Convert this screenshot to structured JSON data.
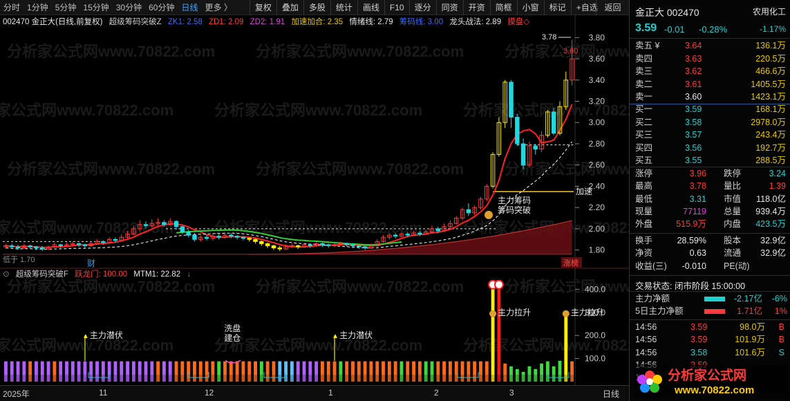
{
  "toolbar": {
    "periods": [
      "分时",
      "1分钟",
      "5分钟",
      "15分钟",
      "30分钟",
      "60分钟",
      "日线",
      "更多 〉"
    ],
    "active_period": "日线",
    "tools": [
      "复权",
      "叠加",
      "多股",
      "统计",
      "画线",
      "F10",
      "逐分",
      "同资",
      "开资",
      "简框",
      "小窗",
      "标记",
      "+自选"
    ],
    "return_label": "返回"
  },
  "legend_main": {
    "code_title": "002470 金正大(日线,前复权)",
    "indicator": "超级筹码突破Z",
    "zk1": "ZK1: 2.58",
    "zd1": "ZD1: 2.09",
    "zd2": "ZD2: 1.91",
    "accel": "加速加合: 2.35",
    "emotion": "情绪线: 2.79",
    "hidden": "筹码线: 3.00",
    "dragon": "龙头战法: 2.89",
    "flag": "摸盘◇"
  },
  "legend_sub": {
    "indicator": "超级筹码突破F",
    "dragon_gate": "跃龙门: 100.00",
    "mtm": "MTM1: 22.82"
  },
  "chart_data": {
    "type": "candlestick",
    "title": "002470 金正大(日线,前复权)",
    "y_main_ticks": [
      3.8,
      3.6,
      3.4,
      3.2,
      3.0,
      2.8,
      2.6,
      2.4,
      2.2,
      2.0,
      1.8
    ],
    "y_main_range": [
      1.7,
      3.88
    ],
    "y_sub_ticks": [
      400.0,
      300.0,
      200.0,
      100.0
    ],
    "y_sub_range": [
      0,
      440
    ],
    "x_labels": [
      "2025年",
      "11",
      "12",
      "1",
      "2",
      "3"
    ],
    "annotations": {
      "high_mark": "3.78",
      "close_mark": "3.60",
      "low_mark": "1.70",
      "accel_label": "加速",
      "breakout_labels": [
        "主力筹码",
        "筹码突破"
      ],
      "finance_tag": "财",
      "limit_tag": "涨榜"
    },
    "sub_annotations": [
      "主力潜伏",
      "洗盘建仓",
      "主力潜伏",
      "主力拉升",
      "主力拉升"
    ],
    "candles": [
      [
        1.83,
        1.84,
        1.86,
        1.81
      ],
      [
        1.84,
        1.83,
        1.86,
        1.81
      ],
      [
        1.83,
        1.82,
        1.85,
        1.8
      ],
      [
        1.82,
        1.84,
        1.86,
        1.81
      ],
      [
        1.84,
        1.83,
        1.85,
        1.81
      ],
      [
        1.83,
        1.82,
        1.84,
        1.8
      ],
      [
        1.82,
        1.81,
        1.84,
        1.79
      ],
      [
        1.81,
        1.83,
        1.84,
        1.8
      ],
      [
        1.83,
        1.85,
        1.87,
        1.82
      ],
      [
        1.85,
        1.84,
        1.86,
        1.82
      ],
      [
        1.84,
        1.85,
        1.87,
        1.83
      ],
      [
        1.85,
        1.86,
        1.88,
        1.84
      ],
      [
        1.86,
        1.85,
        1.87,
        1.83
      ],
      [
        1.85,
        1.84,
        1.86,
        1.82
      ],
      [
        1.84,
        1.86,
        1.88,
        1.83
      ],
      [
        1.86,
        1.88,
        1.9,
        1.85
      ],
      [
        1.88,
        1.87,
        1.89,
        1.85
      ],
      [
        1.87,
        1.9,
        1.92,
        1.86
      ],
      [
        1.9,
        1.89,
        1.92,
        1.87
      ],
      [
        1.89,
        1.92,
        1.95,
        1.88
      ],
      [
        1.92,
        1.95,
        1.98,
        1.91
      ],
      [
        1.95,
        2.0,
        2.03,
        1.94
      ],
      [
        2.0,
        2.04,
        2.08,
        1.98
      ],
      [
        2.04,
        2.03,
        2.07,
        2.0
      ],
      [
        2.03,
        2.05,
        2.09,
        2.01
      ],
      [
        2.05,
        2.06,
        2.1,
        2.03
      ],
      [
        2.06,
        2.04,
        2.08,
        2.02
      ],
      [
        2.04,
        2.07,
        2.1,
        2.03
      ],
      [
        2.07,
        2.02,
        2.08,
        1.99
      ],
      [
        2.02,
        1.97,
        2.03,
        1.95
      ],
      [
        1.97,
        1.94,
        1.99,
        1.92
      ],
      [
        1.94,
        1.9,
        1.96,
        1.88
      ],
      [
        1.9,
        1.92,
        1.94,
        1.88
      ],
      [
        1.92,
        1.91,
        1.94,
        1.89
      ],
      [
        1.91,
        1.93,
        1.95,
        1.89
      ],
      [
        1.93,
        1.92,
        1.95,
        1.9
      ],
      [
        1.92,
        1.94,
        1.96,
        1.91
      ],
      [
        1.94,
        1.93,
        1.96,
        1.91
      ],
      [
        1.93,
        1.92,
        1.94,
        1.9
      ],
      [
        1.92,
        1.91,
        1.93,
        1.89
      ],
      [
        1.91,
        1.9,
        1.92,
        1.88
      ],
      [
        1.9,
        1.88,
        1.91,
        1.86
      ],
      [
        1.88,
        1.86,
        1.89,
        1.84
      ],
      [
        1.86,
        1.84,
        1.87,
        1.82
      ],
      [
        1.84,
        1.82,
        1.85,
        1.8
      ],
      [
        1.82,
        1.81,
        1.84,
        1.79
      ],
      [
        1.81,
        1.83,
        1.85,
        1.8
      ],
      [
        1.83,
        1.84,
        1.86,
        1.82
      ],
      [
        1.84,
        1.83,
        1.85,
        1.81
      ],
      [
        1.83,
        1.85,
        1.87,
        1.82
      ],
      [
        1.85,
        1.84,
        1.86,
        1.82
      ],
      [
        1.84,
        1.86,
        1.88,
        1.83
      ],
      [
        1.86,
        1.85,
        1.87,
        1.83
      ],
      [
        1.85,
        1.84,
        1.86,
        1.82
      ],
      [
        1.84,
        1.85,
        1.87,
        1.83
      ],
      [
        1.85,
        1.86,
        1.88,
        1.84
      ],
      [
        1.86,
        1.85,
        1.87,
        1.83
      ],
      [
        1.85,
        1.84,
        1.86,
        1.82
      ],
      [
        1.84,
        1.83,
        1.85,
        1.81
      ],
      [
        1.83,
        1.82,
        1.84,
        1.8
      ],
      [
        1.82,
        1.84,
        1.86,
        1.81
      ],
      [
        1.84,
        1.88,
        1.9,
        1.83
      ],
      [
        1.88,
        1.92,
        1.94,
        1.87
      ],
      [
        1.92,
        1.94,
        1.96,
        1.9
      ],
      [
        1.94,
        1.93,
        1.96,
        1.91
      ],
      [
        1.93,
        1.95,
        1.97,
        1.92
      ],
      [
        1.95,
        1.94,
        1.97,
        1.92
      ],
      [
        1.94,
        1.96,
        1.98,
        1.93
      ],
      [
        1.96,
        1.95,
        1.98,
        1.93
      ],
      [
        1.95,
        1.97,
        1.99,
        1.94
      ],
      [
        1.97,
        2.0,
        2.03,
        1.96
      ],
      [
        2.0,
        1.98,
        2.02,
        1.96
      ],
      [
        1.98,
        2.02,
        2.05,
        1.97
      ],
      [
        2.02,
        2.05,
        2.08,
        2.0
      ],
      [
        2.05,
        2.1,
        2.12,
        2.04
      ],
      [
        2.1,
        2.18,
        2.2,
        2.08
      ],
      [
        2.18,
        2.15,
        2.24,
        2.12
      ],
      [
        2.15,
        2.2,
        2.22,
        2.13
      ],
      [
        2.2,
        2.28,
        2.3,
        2.18
      ],
      [
        2.28,
        2.4,
        2.42,
        2.26
      ],
      [
        2.4,
        2.7,
        2.72,
        2.38
      ],
      [
        2.7,
        3.0,
        3.05,
        2.68
      ],
      [
        3.0,
        3.38,
        3.4,
        2.95
      ],
      [
        3.38,
        3.05,
        3.4,
        2.95
      ],
      [
        3.05,
        2.8,
        3.08,
        2.78
      ],
      [
        2.8,
        2.6,
        2.85,
        2.56
      ],
      [
        2.6,
        2.78,
        2.82,
        2.58
      ],
      [
        2.78,
        2.75,
        2.8,
        2.7
      ],
      [
        2.75,
        2.88,
        2.92,
        2.72
      ],
      [
        2.88,
        3.1,
        3.12,
        2.86
      ],
      [
        3.1,
        2.9,
        3.14,
        2.88
      ],
      [
        2.9,
        3.15,
        3.2,
        2.88
      ],
      [
        3.15,
        3.4,
        3.48,
        3.12
      ],
      [
        3.4,
        3.6,
        3.78,
        3.35
      ]
    ],
    "sub_bars": [
      [
        88,
        "#b060ff"
      ],
      [
        88,
        "#b060ff"
      ],
      [
        88,
        "#b060ff"
      ],
      [
        88,
        "#b060ff"
      ],
      [
        88,
        "#ff6a1a"
      ],
      [
        88,
        "#b060ff"
      ],
      [
        88,
        "#b060ff"
      ],
      [
        88,
        "#b060ff"
      ],
      [
        88,
        "#ff6a1a"
      ],
      [
        88,
        "#b060ff"
      ],
      [
        88,
        "#b060ff"
      ],
      [
        88,
        "#b060ff"
      ],
      [
        88,
        "#b060ff"
      ],
      [
        88,
        "#b060ff"
      ],
      [
        88,
        "#b060ff"
      ],
      [
        88,
        "#b060ff"
      ],
      [
        88,
        "#b060ff"
      ],
      [
        88,
        "#b060ff"
      ],
      [
        88,
        "#b060ff"
      ],
      [
        88,
        "#b060ff"
      ],
      [
        88,
        "#b060ff"
      ],
      [
        88,
        "#b060ff"
      ],
      [
        88,
        "#b060ff"
      ],
      [
        88,
        "#b060ff"
      ],
      [
        88,
        "#b060ff"
      ],
      [
        88,
        "#ff6a1a"
      ],
      [
        88,
        "#b060ff"
      ],
      [
        88,
        "#b060ff"
      ],
      [
        88,
        "#ff6a1a"
      ],
      [
        88,
        "#ff6a1a"
      ],
      [
        88,
        "#ff6a1a"
      ],
      [
        88,
        "#ff6a1a"
      ],
      [
        88,
        "#ff6a1a"
      ],
      [
        88,
        "#ff6a1a"
      ],
      [
        88,
        "#ff6a1a"
      ],
      [
        88,
        "#40d840"
      ],
      [
        88,
        "#ff6a1a"
      ],
      [
        88,
        "#ff6a1a"
      ],
      [
        88,
        "#ff6a1a"
      ],
      [
        88,
        "#ff6a1a"
      ],
      [
        88,
        "#ff6a1a"
      ],
      [
        88,
        "#ff6a1a"
      ],
      [
        88,
        "#40d840"
      ],
      [
        88,
        "#ff6a1a"
      ],
      [
        88,
        "#ff6a1a"
      ],
      [
        88,
        "#60c0ff"
      ],
      [
        88,
        "#60c0ff"
      ],
      [
        88,
        "#60c0ff"
      ],
      [
        88,
        "#b060ff"
      ],
      [
        88,
        "#b060ff"
      ],
      [
        88,
        "#b060ff"
      ],
      [
        88,
        "#b060ff"
      ],
      [
        88,
        "#ff6a1a"
      ],
      [
        88,
        "#ff6a1a"
      ],
      [
        88,
        "#ff6a1a"
      ],
      [
        88,
        "#40d840"
      ],
      [
        88,
        "#ff6a1a"
      ],
      [
        88,
        "#ff6a1a"
      ],
      [
        88,
        "#ff6a1a"
      ],
      [
        88,
        "#ff6a1a"
      ],
      [
        88,
        "#ff6a1a"
      ],
      [
        88,
        "#ff6a1a"
      ],
      [
        88,
        "#ff6a1a"
      ],
      [
        88,
        "#ff6a1a"
      ],
      [
        88,
        "#ff6a1a"
      ],
      [
        88,
        "#40d840"
      ],
      [
        88,
        "#ff6a1a"
      ],
      [
        88,
        "#ff6a1a"
      ],
      [
        88,
        "#ff6a1a"
      ],
      [
        88,
        "#40d840"
      ],
      [
        88,
        "#40d840"
      ],
      [
        88,
        "#ff6a1a"
      ],
      [
        88,
        "#ff6a1a"
      ],
      [
        88,
        "#ff6a1a"
      ],
      [
        88,
        "#ff6a1a"
      ],
      [
        88,
        "#ff6a1a"
      ],
      [
        88,
        "#ff6a1a"
      ],
      [
        88,
        "#ff6a1a"
      ],
      [
        88,
        "#ff6a1a"
      ],
      [
        88,
        "#ff6a1a"
      ],
      [
        420,
        "#ffee00"
      ],
      [
        420,
        "#ff1a1a"
      ],
      [
        80,
        "#ff6a1a"
      ],
      [
        70,
        "#40d840"
      ],
      [
        60,
        "#40d840"
      ],
      [
        50,
        "#40d840"
      ],
      [
        70,
        "#40d840"
      ],
      [
        60,
        "#40d840"
      ],
      [
        80,
        "#40d840"
      ],
      [
        88,
        "#40d840"
      ],
      [
        70,
        "#40d840"
      ],
      [
        90,
        "#40d840"
      ],
      [
        300,
        "#ffee00"
      ],
      [
        88,
        "#ff6a1a"
      ]
    ]
  },
  "quote": {
    "title": "金正大 002470",
    "industry": "农用化工",
    "price": "3.59",
    "change": "-0.01",
    "pct": "-0.28%",
    "industry_pct": "-1.17%"
  },
  "asks": [
    {
      "label": "卖五 ¥",
      "price": "3.64",
      "vol": "136.1万"
    },
    {
      "label": "卖四",
      "price": "3.63",
      "vol": "220.5万"
    },
    {
      "label": "卖三",
      "price": "3.62",
      "vol": "466.6万"
    },
    {
      "label": "卖二",
      "price": "3.61",
      "vol": "1405.5万"
    },
    {
      "label": "卖一",
      "price": "3.60",
      "vol": "1423.1万"
    }
  ],
  "bids": [
    {
      "label": "买一",
      "price": "3.59",
      "vol": "168.1万"
    },
    {
      "label": "买二",
      "price": "3.58",
      "vol": "2978.0万"
    },
    {
      "label": "买三",
      "price": "3.57",
      "vol": "243.4万"
    },
    {
      "label": "买四",
      "price": "3.56",
      "vol": "192.7万"
    },
    {
      "label": "买五",
      "price": "3.55",
      "vol": "288.5万"
    }
  ],
  "stats": [
    {
      "k1": "涨停",
      "v1": "3.96",
      "c1": "red",
      "k2": "跌停",
      "v2": "3.24",
      "c2": "cyan"
    },
    {
      "k1": "最高",
      "v1": "3.78",
      "c1": "red",
      "k2": "量比",
      "v2": "1.39",
      "c2": "red"
    },
    {
      "k1": "最低",
      "v1": "3.31",
      "c1": "cyan",
      "k2": "市值",
      "v2": "118.0亿",
      "c2": "white"
    },
    {
      "k1": "现量",
      "v1": "77119",
      "c1": "mag",
      "k2": "总量",
      "v2": "939.4万",
      "c2": "white"
    },
    {
      "k1": "外盘",
      "v1": "515.9万",
      "c1": "red",
      "k2": "内盘",
      "v2": "423.5万",
      "c2": "cyan"
    }
  ],
  "stats2": [
    {
      "k1": "换手",
      "v1": "28.59%",
      "c1": "white",
      "k2": "股本",
      "v2": "32.9亿",
      "c2": "white"
    },
    {
      "k1": "净资",
      "v1": "0.63",
      "c1": "white",
      "k2": "流通",
      "v2": "32.9亿",
      "c2": "white"
    },
    {
      "k1": "收益(三)",
      "v1": "-0.010",
      "c1": "white",
      "k2": "PE(动)",
      "v2": "",
      "c2": "white"
    }
  ],
  "trade_status": "交易状态: 闭市阶段 15:00:00",
  "flow": [
    {
      "label": "主力净额",
      "value": "-2.17亿",
      "pct": "-6%",
      "color": "cyan"
    },
    {
      "label": "5日主力净额",
      "value": "1.71亿",
      "pct": "1%",
      "color": "red"
    }
  ],
  "ticks": [
    {
      "time": "14:56",
      "price": "3.59",
      "vol": "98.0万",
      "side": "B"
    },
    {
      "time": "14:56",
      "price": "3.59",
      "vol": "101.9万",
      "side": "B"
    },
    {
      "time": "14:56",
      "price": "3.58",
      "vol": "101.6万",
      "side": "S"
    },
    {
      "time": "14:56",
      "price": "3.59",
      "vol": "",
      "side": ""
    },
    {
      "time": "14:56",
      "price": "",
      "vol": "",
      "side": ""
    }
  ],
  "footer": {
    "period_label": "日线"
  },
  "watermark": "分析家公式网www.70822.com",
  "logo": {
    "name": "分析家公式网",
    "url": "www.70822.com"
  }
}
